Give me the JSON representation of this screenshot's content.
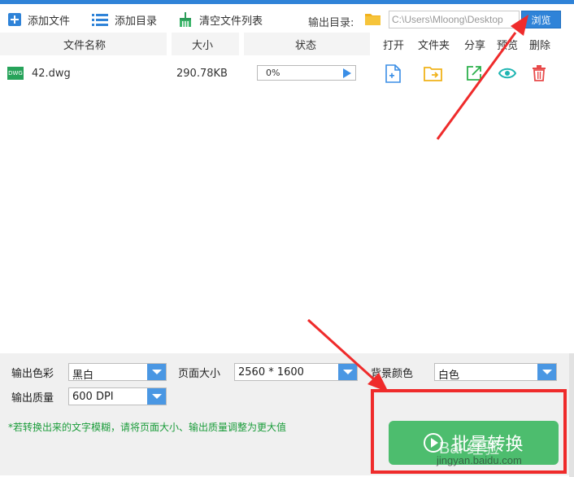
{
  "toolbar": {
    "add_file": "添加文件",
    "add_dir": "添加目录",
    "clear_list": "清空文件列表",
    "output_dir_label": "输出目录:",
    "output_path": "C:\\Users\\Mloong\\Desktop",
    "browse": "浏览"
  },
  "columns": {
    "name": "文件名称",
    "size": "大小",
    "status": "状态",
    "open": "打开",
    "folder": "文件夹",
    "share": "分享",
    "preview": "预览",
    "delete": "删除"
  },
  "files": [
    {
      "badge": "DWG",
      "name": "42.dwg",
      "size": "290.78KB",
      "progress_text": "0%",
      "progress": 0
    }
  ],
  "settings": {
    "color_label": "输出色彩",
    "color_value": "黑白",
    "page_size_label": "页面大小",
    "page_size_value": "2560 * 1600",
    "bg_color_label": "背景颜色",
    "bg_color_value": "白色",
    "quality_label": "输出质量",
    "quality_value": "600 DPI"
  },
  "footer": {
    "note": "*若转换出来的文字模糊，请将页面大小、输出质量调整为更大值",
    "convert": "批量转换"
  },
  "watermark": {
    "line1": "Bai 经验",
    "line2": "jingyan.baidu.com"
  },
  "colors": {
    "accent": "#2f83d8",
    "convert": "#4dbd6e",
    "annotation": "#ef2b2b",
    "note": "#1a9c3a"
  },
  "icons": [
    "plus-icon",
    "list-icon",
    "broom-icon",
    "folder-icon",
    "file-open-icon",
    "folder-move-icon",
    "share-icon",
    "eye-icon",
    "trash-icon",
    "play-icon"
  ]
}
